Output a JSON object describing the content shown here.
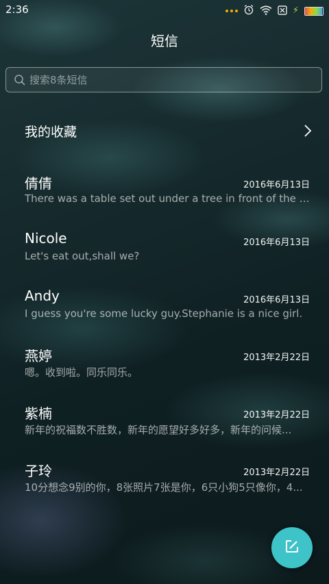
{
  "status_bar": {
    "time": "2:36",
    "battery_level": 0.95,
    "icons": [
      "more-dots-icon",
      "alarm-icon",
      "wifi-icon",
      "no-sim-icon",
      "battery-icon",
      "charging-icon"
    ]
  },
  "header": {
    "title": "短信"
  },
  "search": {
    "placeholder": "搜索8条短信"
  },
  "favorites": {
    "label": "我的收藏"
  },
  "conversations": [
    {
      "name": "倩倩",
      "date": "2016年6月13日",
      "preview": "There was a table set out under a tree in front of the ho..."
    },
    {
      "name": "Nicole",
      "date": "2016年6月13日",
      "preview": "Let's eat out,shall we?"
    },
    {
      "name": "Andy",
      "date": "2016年6月13日",
      "preview": "I guess you're some lucky guy.Stephanie is a nice girl."
    },
    {
      "name": "燕婷",
      "date": "2013年2月22日",
      "preview": "嗯。收到啦。同乐同乐。"
    },
    {
      "name": "紫楠",
      "date": "2013年2月22日",
      "preview": "新年的祝福数不胜数，新年的愿望好多好多，新年的问候..."
    },
    {
      "name": "子玲",
      "date": "2013年2月22日",
      "preview": "10分想念9别的你，8张照片7张是你，6只小狗5只像你，4..."
    }
  ],
  "compose_button": {
    "icon": "compose-icon"
  },
  "colors": {
    "accent": "#3ec4c8",
    "background": "#15292c"
  }
}
